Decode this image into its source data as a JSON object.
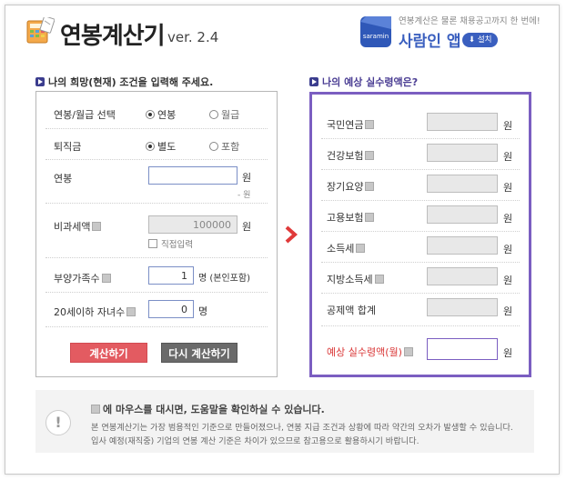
{
  "header": {
    "title": "연봉계산기",
    "version": "ver. 2.4",
    "promo_text": "연봉계산은 물론 채용공고까지 한 번에!",
    "promo_app": "사람인 앱",
    "promo_install": "⬇ 설치",
    "promo_logo_label": "saramin"
  },
  "left": {
    "heading": "나의 희망(현재) 조건을 입력해 주세요.",
    "salary_type": {
      "label": "연봉/월급 선택",
      "options": [
        "연봉",
        "월급"
      ],
      "selected": "연봉"
    },
    "severance": {
      "label": "퇴직금",
      "options": [
        "별도",
        "포함"
      ],
      "selected": "별도"
    },
    "salary": {
      "label": "연봉",
      "value": "",
      "unit": "원",
      "hint": "- 원"
    },
    "nontax": {
      "label": "비과세액",
      "value": "100000",
      "unit": "원",
      "checkbox": "직접입력"
    },
    "dependents": {
      "label": "부양가족수",
      "value": "1",
      "unit": "명 (본인포함)"
    },
    "children": {
      "label": "20세이하 자녀수",
      "value": "0",
      "unit": "명"
    },
    "buttons": {
      "calc": "계산하기",
      "reset": "다시 계산하기"
    }
  },
  "right": {
    "heading": "나의 예상 실수령액은?",
    "unit": "원",
    "rows": [
      {
        "label": "국민연금"
      },
      {
        "label": "건강보험"
      },
      {
        "label": "장기요양"
      },
      {
        "label": "고용보험"
      },
      {
        "label": "소득세"
      },
      {
        "label": "지방소득세"
      },
      {
        "label": "공제액 합계"
      }
    ],
    "result_label": "예상 실수령액(월)"
  },
  "notice": {
    "heading": "에 마우스를 대시면, 도움말을 확인하실 수 있습니다.",
    "line1": "본 연봉계산기는 가장 범용적인 기준으로 만들어졌으나, 연봉 지급 조건과 상황에 따라 약간의 오차가 발생할 수 있습니다.",
    "line2": "입사 예정(재직중) 기업의 연봉 계산 기준은 차이가 있으므로 참고용으로 활용하시기 바랍니다."
  },
  "colors": {
    "accent": "#7b5ec1",
    "calc_button": "#e35b61",
    "reset_button": "#6a6a6a",
    "arrow": "#e03a3a",
    "app_blue": "#3a5fbf"
  }
}
